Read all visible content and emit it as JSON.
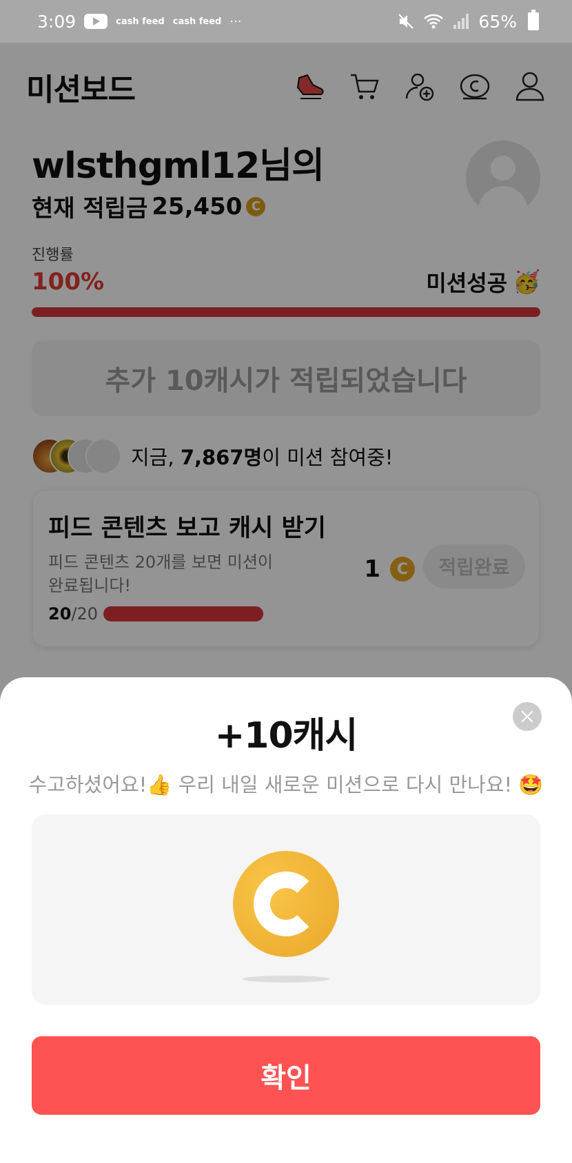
{
  "status_bar": {
    "time": "3:09",
    "app1": "cash feed",
    "app2": "cash feed",
    "more": "···",
    "battery": "65%"
  },
  "header": {
    "title": "미션보드",
    "icons": [
      "shoe-icon",
      "cart-icon",
      "add-user-icon",
      "cash-icon",
      "profile-icon"
    ]
  },
  "user": {
    "name": "wlsthgml12님의",
    "balance_label": "현재 적립금",
    "balance": "25,450",
    "coin_symbol": "C"
  },
  "progress": {
    "label": "진행률",
    "value": "100%",
    "fraction": 1.0,
    "status": "미션성공",
    "status_emoji": "🥳"
  },
  "bonus": {
    "text": "추가 10캐시가 적립되었습니다"
  },
  "participants": {
    "prefix": "지금,",
    "count": "7,867명",
    "suffix": "이 미션 참여중!"
  },
  "mission": {
    "title": "피드 콘텐츠 보고 캐시 받기",
    "description": "피드 콘텐츠 20개를 보면 미션이 완료됩니다!",
    "done": "20",
    "total": "/20",
    "reward": "1",
    "button": "적립완료"
  },
  "sheet": {
    "title": "+10캐시",
    "message": "수고하셨어요!👍 우리 내일 새로운 미션으로 다시 만나요! 🤩",
    "confirm": "확인"
  },
  "colors": {
    "accent": "#ff5252",
    "progress": "#d8363c",
    "coin": "#eaa72a"
  }
}
